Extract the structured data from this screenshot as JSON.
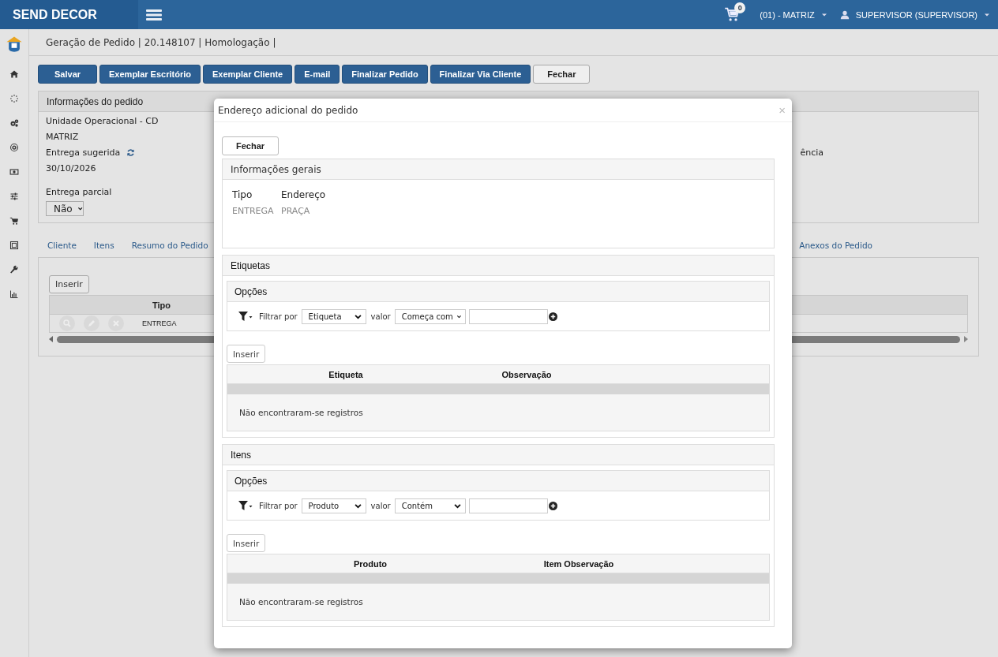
{
  "topbar": {
    "brand": "SEND DECOR",
    "cart_count": "0",
    "unit": "(01) - MATRIZ",
    "user": "SUPERVISOR (SUPERVISOR)"
  },
  "breadcrumb": "Geração de Pedido | 20.148107 | Homologação |",
  "toolbar": [
    {
      "label": "Salvar",
      "kind": "primary"
    },
    {
      "label": "Exemplar Escritório",
      "kind": "primary"
    },
    {
      "label": "Exemplar Cliente",
      "kind": "primary"
    },
    {
      "label": "E-mail",
      "kind": "primary"
    },
    {
      "label": "Finalizar Pedido",
      "kind": "primary"
    },
    {
      "label": "Finalizar Via Cliente",
      "kind": "primary"
    },
    {
      "label": "Fechar",
      "kind": "default"
    }
  ],
  "order_info": {
    "title": "Informações do pedido",
    "unit_label": "Unidade Operacional - CD",
    "unit_value": "MATRIZ",
    "delivery_label": "Entrega sugerida",
    "delivery_date": "30/10/2026",
    "right_fragment": "ência",
    "partial_label": "Entrega parcial",
    "partial_value": "Não"
  },
  "tabs": [
    {
      "label": "Cliente",
      "selected": false
    },
    {
      "label": "Itens",
      "selected": false
    },
    {
      "label": "Resumo do Pedido",
      "selected": false
    },
    {
      "label": "Anexos do Pedido",
      "selected": false
    }
  ],
  "tab_panel": {
    "insert_button": "Inserir",
    "columns": [
      "Tipo"
    ],
    "rows": [
      {
        "tipo": "ENTREGA"
      }
    ]
  },
  "modal": {
    "title": "Endereço adicional do pedido",
    "close": "×",
    "close_button": "Fechar",
    "general": {
      "title": "Informações gerais",
      "columns": [
        "Tipo",
        "Endereço"
      ],
      "values": [
        "ENTREGA",
        "PRAÇA"
      ]
    },
    "sections": [
      {
        "title": "Etiquetas",
        "options_title": "Opções",
        "filter_label": "Filtrar por",
        "filter_field": "Etiqueta",
        "value_label": "valor",
        "operator": "Começa com",
        "insert_button": "Inserir",
        "columns": [
          "Etiqueta",
          "Observação"
        ],
        "empty_text": "Não encontraram-se registros"
      },
      {
        "title": "Itens",
        "options_title": "Opções",
        "filter_label": "Filtrar por",
        "filter_field": "Produto",
        "value_label": "valor",
        "operator": "Contém",
        "insert_button": "Inserir",
        "columns": [
          "Produto",
          "Item Observação"
        ],
        "empty_text": "Não encontraram-se registros"
      }
    ]
  }
}
